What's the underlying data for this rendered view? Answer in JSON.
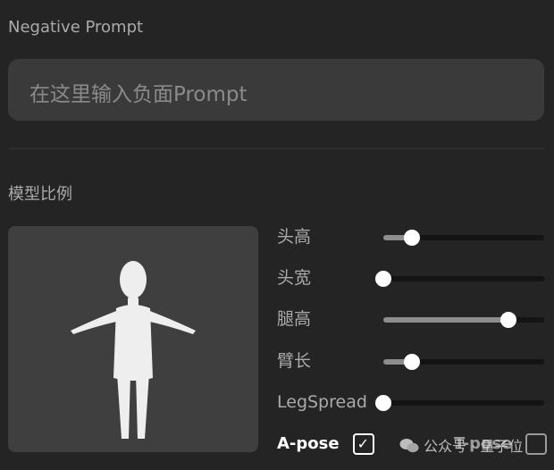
{
  "negative_prompt": {
    "label": "Negative Prompt",
    "placeholder": "在这里输入负面Prompt"
  },
  "model_ratio": {
    "label": "模型比例",
    "sliders": [
      {
        "label": "头高",
        "value": 0.18
      },
      {
        "label": "头宽",
        "value": 0.0
      },
      {
        "label": "腿高",
        "value": 0.78
      },
      {
        "label": "臂长",
        "value": 0.18
      },
      {
        "label": "LegSpread",
        "value": 0.0
      }
    ]
  },
  "pose": {
    "a_pose_label": "A-pose",
    "a_pose_checked": true,
    "t_pose_label": "T-pose",
    "t_pose_checked": false
  },
  "watermark": {
    "text": "公众号 · 量子位",
    "icon": "wechat-icon"
  },
  "colors": {
    "background": "#242424",
    "input_bg": "#3a3a3a",
    "preview_bg": "#3f3f3f",
    "slider_track": "#141414",
    "slider_fill": "#8d8d8d",
    "thumb": "#ffffff"
  }
}
